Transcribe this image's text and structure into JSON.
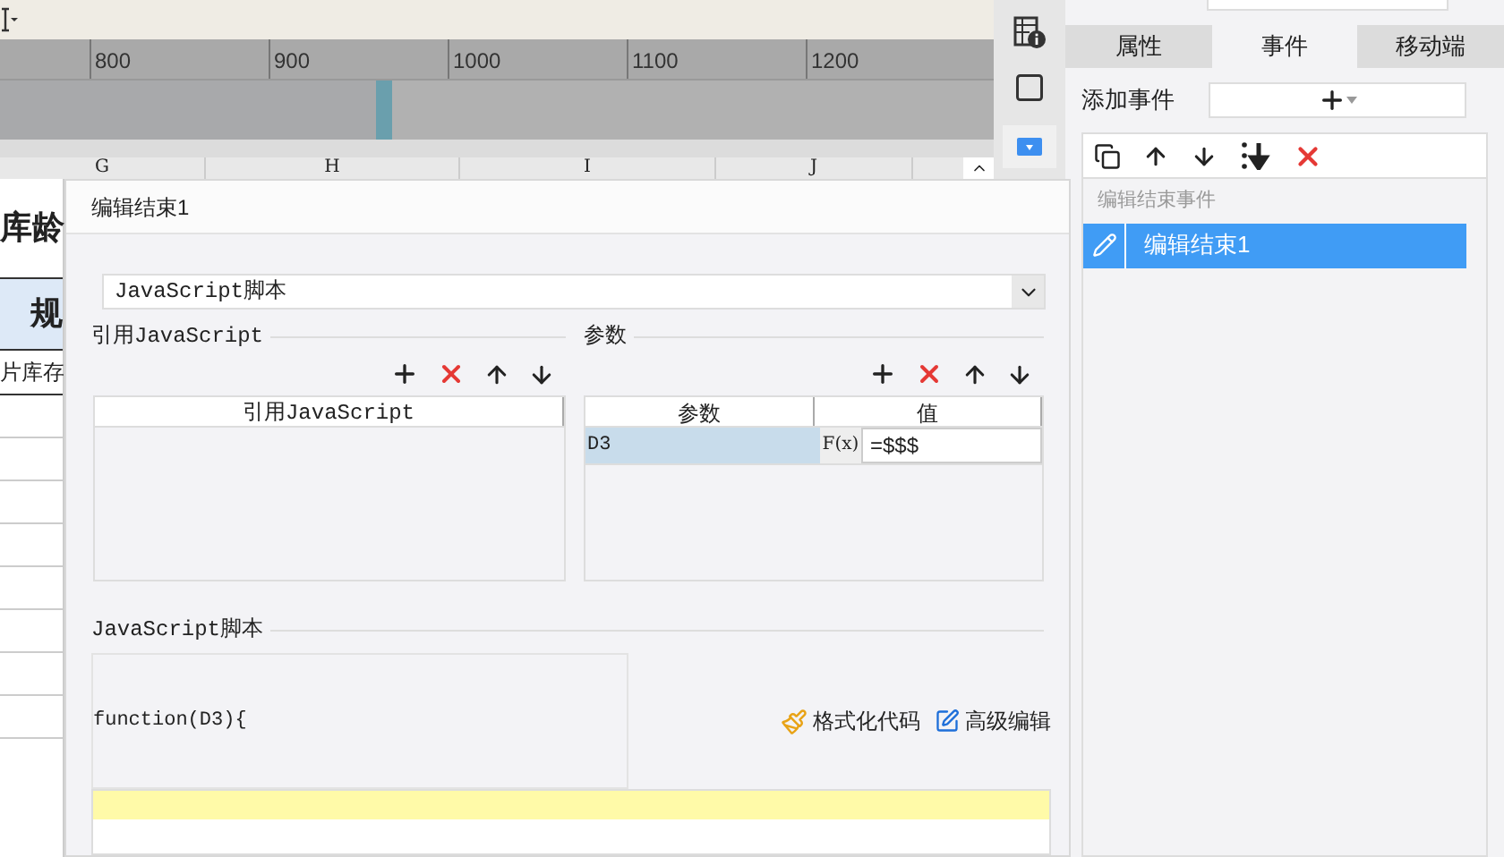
{
  "ruler": {
    "ticks": [
      "800",
      "900",
      "1000",
      "1100",
      "1200"
    ]
  },
  "sheet": {
    "columns": [
      "G",
      "H",
      "I",
      "J"
    ],
    "title_cell": "库龄",
    "header_cell": "规",
    "body_cell": "片库存"
  },
  "side_panel": {
    "tabs": [
      {
        "label": "属性",
        "selected": false
      },
      {
        "label": "事件",
        "selected": true
      },
      {
        "label": "移动端",
        "selected": false
      }
    ],
    "add_event_label": "添加事件",
    "event_group": "编辑结束事件",
    "events": [
      {
        "label": "编辑结束1",
        "selected": true
      }
    ]
  },
  "dialog": {
    "title": "编辑结束1",
    "script_type": "JavaScript脚本",
    "imports": {
      "title": "引用JavaScript",
      "columns": [
        "引用JavaScript"
      ]
    },
    "params": {
      "title": "参数",
      "columns": [
        "参数",
        "值"
      ],
      "rows": [
        {
          "name": "D3",
          "formula_label": "F(x)",
          "value": "=$$$",
          "selected": true
        }
      ]
    },
    "script": {
      "title": "JavaScript脚本",
      "signature": "function(D3){",
      "format_button": "格式化代码",
      "advanced_button": "高级编辑"
    }
  }
}
